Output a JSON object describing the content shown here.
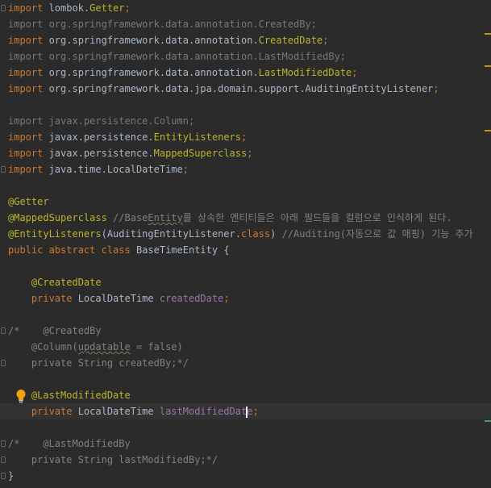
{
  "editor": {
    "lines": [
      [
        {
          "c": "kw",
          "t": "import "
        },
        {
          "c": "plain",
          "t": "lombok."
        },
        {
          "c": "ann",
          "t": "Getter"
        },
        {
          "c": "kw",
          "t": ";"
        }
      ],
      [
        {
          "c": "unused",
          "t": "import org.springframework.data.annotation.CreatedBy;"
        }
      ],
      [
        {
          "c": "kw",
          "t": "import "
        },
        {
          "c": "plain",
          "t": "org.springframework.data.annotation."
        },
        {
          "c": "ann",
          "t": "CreatedDate"
        },
        {
          "c": "kw",
          "t": ";"
        }
      ],
      [
        {
          "c": "unused",
          "t": "import org.springframework.data.annotation.LastModifiedBy;"
        }
      ],
      [
        {
          "c": "kw",
          "t": "import "
        },
        {
          "c": "plain",
          "t": "org.springframework.data.annotation."
        },
        {
          "c": "ann",
          "t": "LastModifiedDate"
        },
        {
          "c": "kw",
          "t": ";"
        }
      ],
      [
        {
          "c": "kw",
          "t": "import "
        },
        {
          "c": "plain",
          "t": "org.springframework.data.jpa.domain.support.AuditingEntityListener"
        },
        {
          "c": "kw",
          "t": ";"
        }
      ],
      [],
      [
        {
          "c": "unused",
          "t": "import javax.persistence.Column;"
        }
      ],
      [
        {
          "c": "kw",
          "t": "import "
        },
        {
          "c": "plain",
          "t": "javax.persistence."
        },
        {
          "c": "ann",
          "t": "EntityListeners"
        },
        {
          "c": "kw",
          "t": ";"
        }
      ],
      [
        {
          "c": "kw",
          "t": "import "
        },
        {
          "c": "plain",
          "t": "javax.persistence."
        },
        {
          "c": "ann",
          "t": "MappedSuperclass"
        },
        {
          "c": "kw",
          "t": ";"
        }
      ],
      [
        {
          "c": "kw",
          "t": "import "
        },
        {
          "c": "plain",
          "t": "java.time.LocalDateTime"
        },
        {
          "c": "kw",
          "t": ";"
        }
      ],
      [],
      [
        {
          "c": "ann",
          "t": "@Getter"
        }
      ],
      [
        {
          "c": "ann",
          "t": "@MappedSuperclass "
        },
        {
          "c": "comment",
          "t": "//Base"
        },
        {
          "c": "comment squiggle",
          "t": "Entity"
        },
        {
          "c": "comment",
          "t": "를 상속한 엔티티들은 아래 필드들을 컬럼으로 인식하게 된다."
        }
      ],
      [
        {
          "c": "ann",
          "t": "@EntityListeners"
        },
        {
          "c": "plain",
          "t": "(AuditingEntityListener."
        },
        {
          "c": "kw",
          "t": "class"
        },
        {
          "c": "plain",
          "t": ") "
        },
        {
          "c": "comment",
          "t": "//Auditing(자동으로 값 매핑) 기능 추가"
        }
      ],
      [
        {
          "c": "kw",
          "t": "public abstract class "
        },
        {
          "c": "plain",
          "t": "BaseTimeEntity {"
        }
      ],
      [],
      [
        {
          "c": "plain",
          "t": "    "
        },
        {
          "c": "ann",
          "t": "@CreatedDate"
        }
      ],
      [
        {
          "c": "plain",
          "t": "    "
        },
        {
          "c": "kw",
          "t": "private "
        },
        {
          "c": "plain",
          "t": "LocalDateTime "
        },
        {
          "c": "field",
          "t": "createdDate"
        },
        {
          "c": "kw",
          "t": ";"
        }
      ],
      [],
      [
        {
          "c": "comment",
          "t": "/*    @CreatedBy"
        }
      ],
      [
        {
          "c": "comment",
          "t": "    @Column("
        },
        {
          "c": "comment squiggle",
          "t": "updatable"
        },
        {
          "c": "comment",
          "t": " = false)"
        }
      ],
      [
        {
          "c": "comment",
          "t": "    private String createdBy;*/"
        }
      ],
      [],
      [
        {
          "c": "plain",
          "t": "    "
        },
        {
          "c": "ann",
          "t": "@LastModifiedDate"
        }
      ],
      [
        {
          "c": "plain",
          "t": "    "
        },
        {
          "c": "kw",
          "t": "private "
        },
        {
          "c": "plain",
          "t": "LocalDateTime "
        },
        {
          "c": "field",
          "t": "lastModifiedDat"
        },
        {
          "c": "caret",
          "t": ""
        },
        {
          "c": "field",
          "t": "e"
        },
        {
          "c": "kw",
          "t": ";"
        }
      ],
      [],
      [
        {
          "c": "comment",
          "t": "/*    @LastModifiedBy"
        }
      ],
      [
        {
          "c": "comment",
          "t": "    private String lastModifiedBy;*/"
        }
      ],
      [
        {
          "c": "plain",
          "t": "}"
        }
      ]
    ],
    "current_line": 25,
    "icons": {
      "bulb": "lightbulb-icon",
      "fold": "fold-marker-icon"
    },
    "colors": {
      "background": "#2b2b2b",
      "keyword": "#cc7832",
      "annotation": "#bbb529",
      "comment": "#808080",
      "field": "#9876aa",
      "text": "#a9b7c6"
    }
  }
}
